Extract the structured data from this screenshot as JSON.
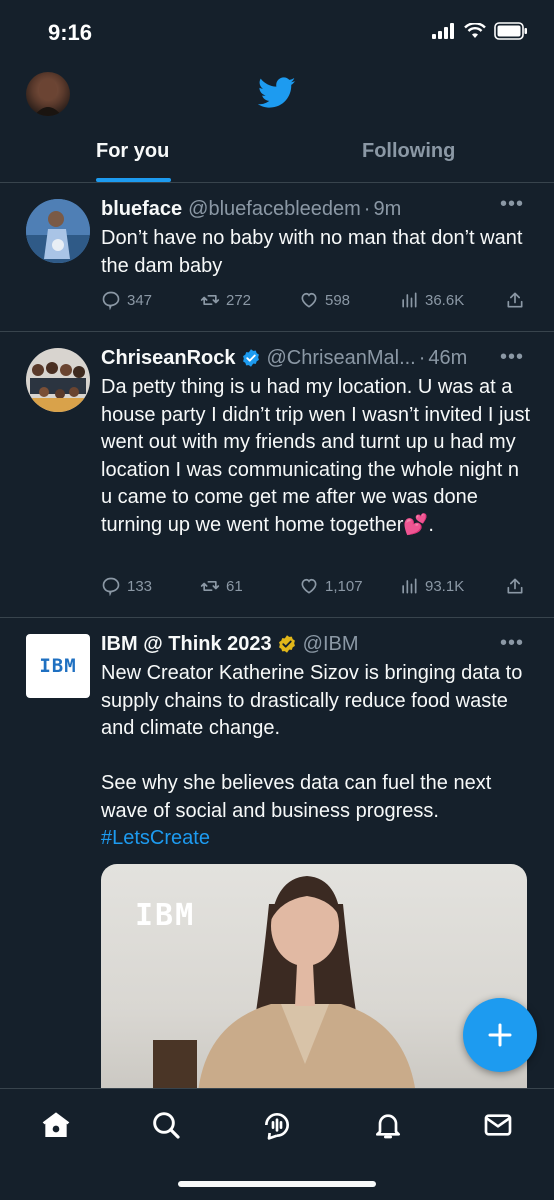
{
  "status_bar": {
    "time": "9:16",
    "icons": [
      "signal-icon",
      "wifi-icon",
      "battery-icon"
    ]
  },
  "header": {
    "logo": "twitter-bird-icon"
  },
  "tabs": [
    {
      "label": "For you",
      "active": true
    },
    {
      "label": "Following",
      "active": false
    }
  ],
  "tweets": [
    {
      "name": "blueface",
      "handle": "@bluefacebleedem",
      "sep": "·",
      "time": "9m",
      "text": "Don’t have no baby with no man that don’t want the dam baby",
      "replies": "347",
      "retweets": "272",
      "likes": "598",
      "views": "36.6K"
    },
    {
      "name": "ChriseanRock",
      "verified": "blue",
      "handle": "@ChriseanMal...",
      "sep": "·",
      "time": "46m",
      "text": "Da petty thing is u had my location. U was at a house party I didn’t trip wen I wasn’t invited I just went out with my friends and turnt up u had my location I was communicating the whole night n u came to come get me after we was done turning up we went home together💕.",
      "replies": "133",
      "retweets": "61",
      "likes": "1,107",
      "views": "93.1K"
    },
    {
      "name": "IBM @ Think 2023",
      "verified": "gold",
      "handle": "@IBM",
      "avatar_text": "IBM",
      "text_p1": "New Creator Katherine Sizov is bringing data to supply chains to drastically reduce food waste and climate change.",
      "text_p2": "See why she believes data can fuel the next wave of social and business progress.",
      "hashtag": "#LetsCreate",
      "media_logo": "IBM"
    }
  ],
  "fab": {
    "icon": "plus-icon"
  },
  "bottom_nav": [
    "home-icon",
    "search-icon",
    "spaces-icon",
    "notifications-icon",
    "messages-icon"
  ],
  "colors": {
    "accent": "#1d9bf0",
    "background": "#15202b",
    "muted": "#8b98a5",
    "gold_badge": "#e2b719"
  }
}
